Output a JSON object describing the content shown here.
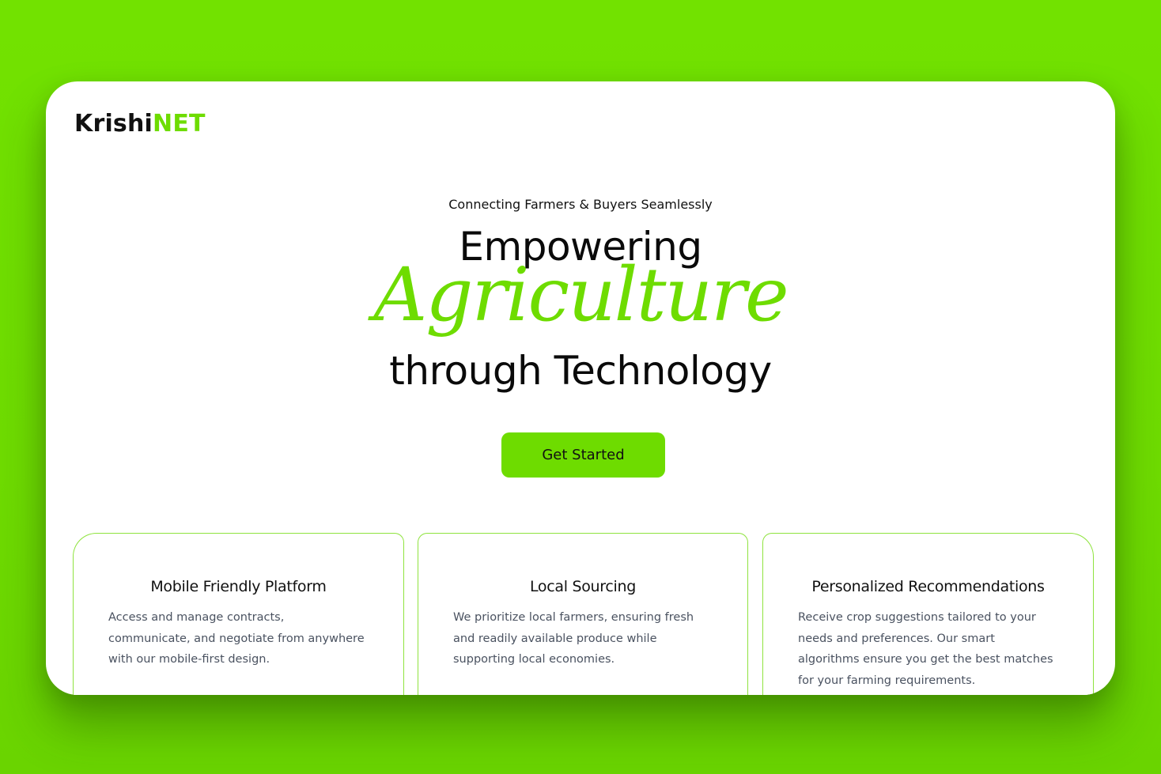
{
  "brand": {
    "name_part1": "Krishi",
    "name_part2": "NET",
    "accent_color": "#6edc00"
  },
  "hero": {
    "tagline": "Connecting Farmers & Buyers Seamlessly",
    "heading_line1": "Empowering",
    "heading_script": "Agriculture",
    "heading_line3": "through Technology",
    "cta_label": "Get Started"
  },
  "features": [
    {
      "title": "Mobile Friendly Platform",
      "description": "Access and manage contracts, communicate, and negotiate from anywhere with our mobile-first design."
    },
    {
      "title": "Local Sourcing",
      "description": "We prioritize local farmers, ensuring fresh and readily available produce while supporting local economies."
    },
    {
      "title": "Personalized Recommendations",
      "description": "Receive crop suggestions tailored to your needs and preferences. Our smart algorithms ensure you get the best matches for your farming requirements."
    }
  ],
  "colors": {
    "background": "#72e200",
    "text": "#111111",
    "muted_text": "#4a5260"
  }
}
